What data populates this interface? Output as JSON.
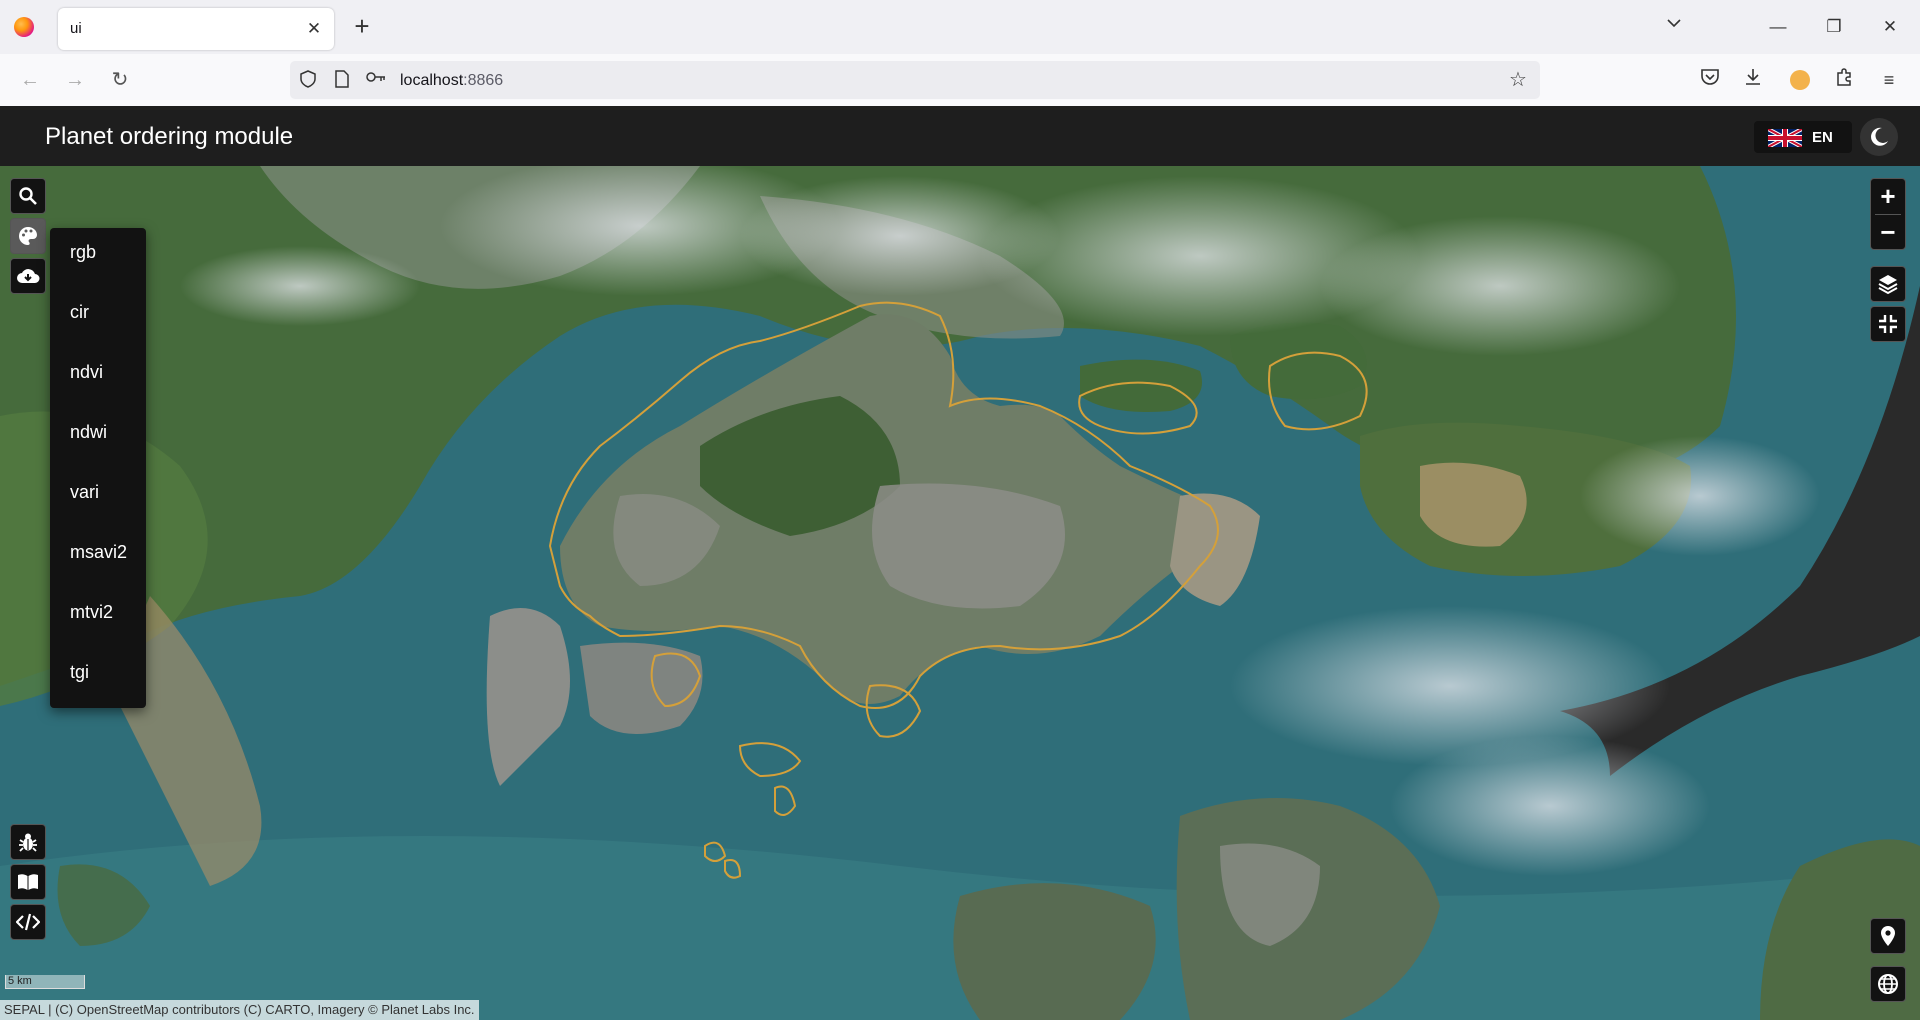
{
  "browser": {
    "tab_title": "ui",
    "new_tab": "+",
    "url_host": "localhost",
    "url_port": ":8866"
  },
  "app": {
    "title": "Planet ordering module",
    "language": "EN"
  },
  "visualization_menu": {
    "items": [
      "rgb",
      "cir",
      "ndvi",
      "ndwi",
      "vari",
      "msavi2",
      "mtvi2",
      "tgi"
    ]
  },
  "map": {
    "scale_label": "5 km",
    "attribution": "SEPAL | (C) OpenStreetMap contributors (C) CARTO, Imagery © Planet Labs Inc.",
    "boundary_color": "#d4a03a",
    "water_color": "#2f6e79",
    "land_color": "#4b6e3e",
    "urban_color": "#8a8a86"
  },
  "icons": {
    "left_top": [
      "search-icon",
      "palette-icon",
      "cloud-download-icon"
    ],
    "left_bottom": [
      "bug-icon",
      "book-icon",
      "code-icon"
    ],
    "right": [
      "zoom-in-icon",
      "zoom-out-icon",
      "layers-icon",
      "fullscreen-exit-icon",
      "map-marker-icon",
      "globe-icon"
    ]
  }
}
